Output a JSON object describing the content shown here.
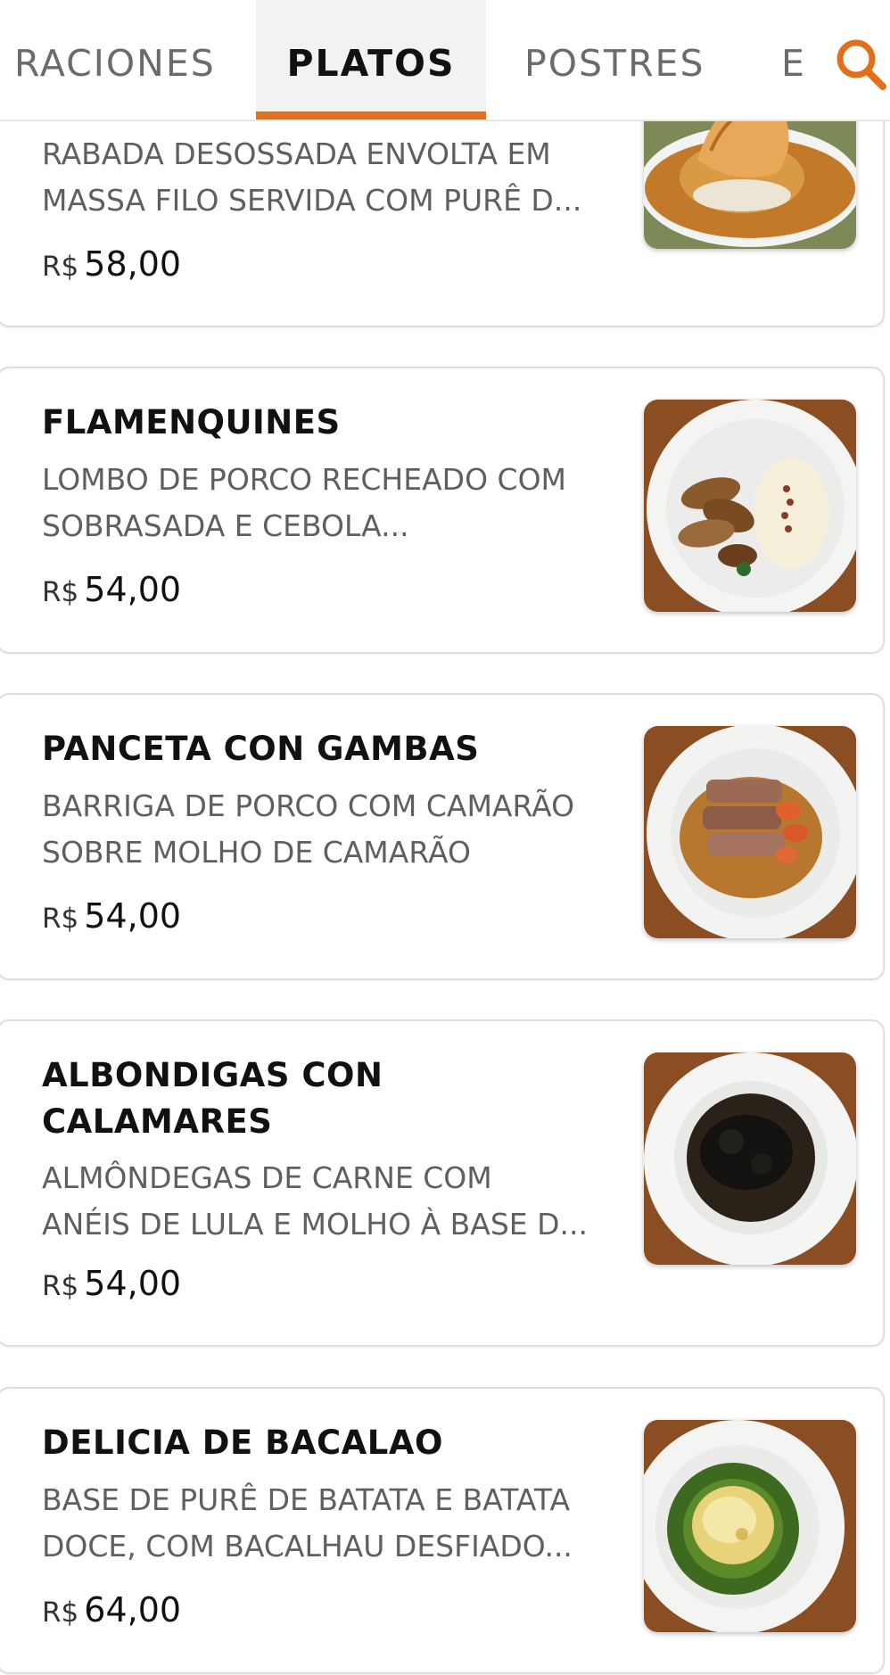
{
  "tabs": [
    {
      "label": "RACIONES"
    },
    {
      "label": "PLATOS"
    },
    {
      "label": "POSTRES"
    },
    {
      "label": "E"
    }
  ],
  "active_tab": "PLATOS",
  "search": {
    "icon": "search-icon",
    "color": "#e16f1b"
  },
  "accent_color": "#e16f1b",
  "currency": "R$",
  "dishes": [
    {
      "title": "",
      "description": [
        "RABADA DESOSSADA ENVOLTA EM",
        "MASSA FILO SERVIDA COM PURÊ D..."
      ],
      "price": "58,00"
    },
    {
      "title": "FLAMENQUINES",
      "description": [
        "LOMBO DE PORCO RECHEADO COM",
        "SOBRASADA E CEBOLA..."
      ],
      "price": "54,00"
    },
    {
      "title": "PANCETA CON GAMBAS",
      "description": [
        "BARRIGA DE PORCO COM CAMARÃO",
        "SOBRE MOLHO DE CAMARÃO"
      ],
      "price": "54,00"
    },
    {
      "title": "ALBONDIGAS CON CALAMARES",
      "description": [
        "ALMÔNDEGAS DE CARNE COM",
        "ANÉIS DE LULA E MOLHO À BASE D..."
      ],
      "price": "54,00"
    },
    {
      "title": "DELICIA DE BACALAO",
      "description": [
        "BASE DE PURÊ DE BATATA E BATATA",
        "DOCE, COM BACALHAU DESFIADO..."
      ],
      "price": "64,00"
    }
  ]
}
